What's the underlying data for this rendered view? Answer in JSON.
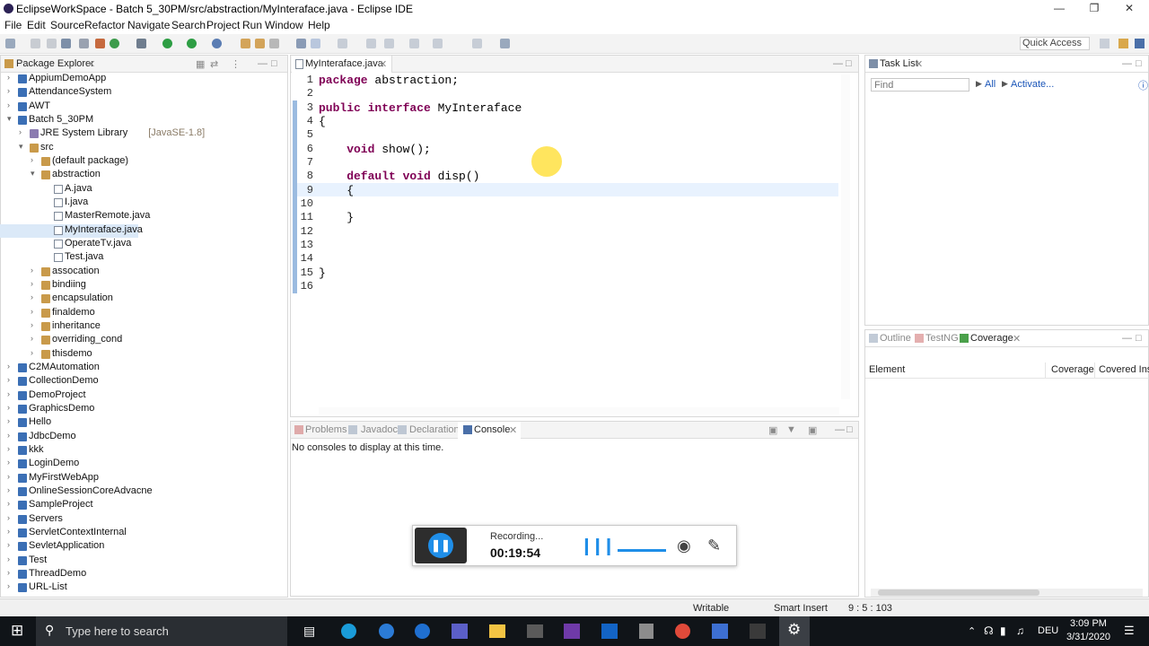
{
  "window": {
    "title": "EclipseWorkSpace - Batch 5_30PM/src/abstraction/MyInteraface.java - Eclipse IDE"
  },
  "menu": [
    "File",
    "Edit",
    "Source",
    "Refactor",
    "Navigate",
    "Search",
    "Project",
    "Run",
    "Window",
    "Help"
  ],
  "quick_access": "Quick Access",
  "package_explorer": {
    "title": "Package Explorer",
    "items": [
      {
        "label": "AppiumDemoApp",
        "type": "proj"
      },
      {
        "label": "AttendanceSystem",
        "type": "proj"
      },
      {
        "label": "AWT",
        "type": "proj"
      },
      {
        "label": "Batch 5_30PM",
        "type": "proj"
      },
      {
        "label": "JRE System Library",
        "suffix": "[JavaSE-1.8]",
        "type": "lib"
      },
      {
        "label": "src",
        "type": "pkg"
      },
      {
        "label": "(default package)",
        "type": "pkg"
      },
      {
        "label": "abstraction",
        "type": "pkg"
      },
      {
        "label": "A.java",
        "type": "file"
      },
      {
        "label": "I.java",
        "type": "file"
      },
      {
        "label": "MasterRemote.java",
        "type": "file"
      },
      {
        "label": "MyInteraface.java",
        "type": "file"
      },
      {
        "label": "OperateTv.java",
        "type": "file"
      },
      {
        "label": "Test.java",
        "type": "file"
      },
      {
        "label": "assocation",
        "type": "pkg"
      },
      {
        "label": "bindiing",
        "type": "pkg"
      },
      {
        "label": "encapsulation",
        "type": "pkg"
      },
      {
        "label": "finaldemo",
        "type": "pkg"
      },
      {
        "label": "inheritance",
        "type": "pkg"
      },
      {
        "label": "overriding_cond",
        "type": "pkg"
      },
      {
        "label": "thisdemo",
        "type": "pkg"
      },
      {
        "label": "C2MAutomation",
        "type": "proj"
      },
      {
        "label": "CollectionDemo",
        "type": "proj"
      },
      {
        "label": "DemoProject",
        "type": "proj"
      },
      {
        "label": "GraphicsDemo",
        "type": "proj"
      },
      {
        "label": "Hello",
        "type": "proj"
      },
      {
        "label": "JdbcDemo",
        "type": "proj"
      },
      {
        "label": "kkk",
        "type": "proj"
      },
      {
        "label": "LoginDemo",
        "type": "proj"
      },
      {
        "label": "MyFirstWebApp",
        "type": "proj"
      },
      {
        "label": "OnlineSessionCoreAdvacne",
        "type": "proj"
      },
      {
        "label": "SampleProject",
        "type": "proj"
      },
      {
        "label": "Servers",
        "type": "proj"
      },
      {
        "label": "ServletContextInternal",
        "type": "proj"
      },
      {
        "label": "SevletApplication",
        "type": "proj"
      },
      {
        "label": "Test",
        "type": "proj"
      },
      {
        "label": "ThreadDemo",
        "type": "proj"
      },
      {
        "label": "URL-List",
        "type": "proj"
      }
    ]
  },
  "editor": {
    "tab": "MyInteraface.java",
    "line_numbers": [
      "1",
      "2",
      "3",
      "4",
      "5",
      "6",
      "7",
      "8",
      "9",
      "10",
      "11",
      "12",
      "13",
      "14",
      "15",
      "16"
    ],
    "lines": [
      {
        "kw": "package",
        "rest": " abstraction;"
      },
      {
        "kw": "",
        "rest": ""
      },
      {
        "kw": "public interface",
        "rest": " MyInteraface"
      },
      {
        "kw": "",
        "rest": "{"
      },
      {
        "kw": "",
        "rest": ""
      },
      {
        "kw": "    void",
        "rest": " show();"
      },
      {
        "kw": "",
        "rest": ""
      },
      {
        "kw": "    default void",
        "rest": " disp()"
      },
      {
        "kw": "",
        "rest": "    {"
      },
      {
        "kw": "",
        "rest": ""
      },
      {
        "kw": "",
        "rest": "    }"
      },
      {
        "kw": "",
        "rest": ""
      },
      {
        "kw": "",
        "rest": ""
      },
      {
        "kw": "",
        "rest": ""
      },
      {
        "kw": "",
        "rest": "}"
      },
      {
        "kw": "",
        "rest": ""
      }
    ]
  },
  "bottom": {
    "tabs": [
      "Problems",
      "Javadoc",
      "Declaration",
      "Console"
    ],
    "message": "No consoles to display at this time."
  },
  "task_list": {
    "title": "Task List",
    "find_placeholder": "Find",
    "all": "All",
    "activate": "Activate..."
  },
  "coverage": {
    "tabs": [
      "Outline",
      "TestNG",
      "Coverage"
    ],
    "columns": [
      "Element",
      "Coverage",
      "Covered Inst"
    ]
  },
  "status": {
    "writable": "Writable",
    "insert": "Smart Insert",
    "position": "9 : 5 : 103"
  },
  "recorder": {
    "label": "Recording...",
    "time": "00:19:54"
  },
  "taskbar": {
    "search": "Type here to search",
    "lang": "DEU",
    "time": "3:09 PM",
    "date": "3/31/2020"
  },
  "colors": {
    "keyword": "#7f0055",
    "accent": "#3b6fb5"
  }
}
